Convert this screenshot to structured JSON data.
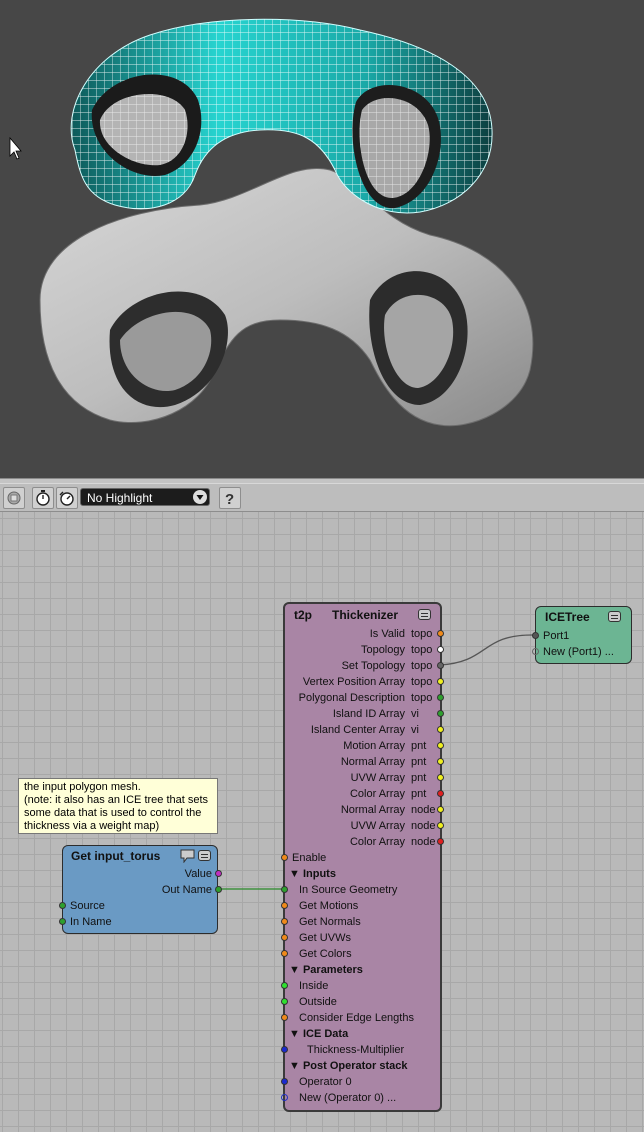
{
  "toolbar": {
    "highlight_value": "No Highlight"
  },
  "colors": {
    "viewport_bg": "#474747",
    "graph_bg": "#b9b9b9",
    "thickenizer_node": "#a985a5",
    "get_node": "#6a9ac4",
    "icetree_node": "#6cb593",
    "comment_bg": "#ffffd8",
    "wireframe_torus": "#25c9c6"
  },
  "comment": {
    "text": "the input polygon mesh.\n(note: it also has an ICE tree that sets some data that is used to control the thickness via a weight map)"
  },
  "get_node": {
    "title": "Get input_torus",
    "outputs": [
      "Value",
      "Out Name"
    ],
    "inputs": [
      "Source",
      "In Name"
    ]
  },
  "thickenizer": {
    "title_prefix": "t2p",
    "title": "Thickenizer",
    "outputs": [
      {
        "label": "Is Valid",
        "type": "topo"
      },
      {
        "label": "Topology",
        "type": "topo"
      },
      {
        "label": "Set Topology",
        "type": "topo"
      },
      {
        "label": "Vertex Position Array",
        "type": "topo"
      },
      {
        "label": "Polygonal Description",
        "type": "topo"
      },
      {
        "label": "Island ID Array",
        "type": "vi"
      },
      {
        "label": "Island Center Array",
        "type": "vi"
      },
      {
        "label": "Motion Array",
        "type": "pnt"
      },
      {
        "label": "Normal Array",
        "type": "pnt"
      },
      {
        "label": "UVW Array",
        "type": "pnt"
      },
      {
        "label": "Color Array",
        "type": "pnt"
      },
      {
        "label": "Normal Array",
        "type": "node"
      },
      {
        "label": "UVW Array",
        "type": "node"
      },
      {
        "label": "Color Array",
        "type": "node"
      }
    ],
    "enable": "Enable",
    "inputs_header": "Inputs",
    "inputs": [
      "In Source Geometry",
      "Get Motions",
      "Get Normals",
      "Get UVWs",
      "Get Colors"
    ],
    "parameters_header": "Parameters",
    "parameters": [
      "Inside",
      "Outside",
      "Consider Edge Lengths"
    ],
    "ice_header": "ICE Data",
    "ice": [
      "Thickness-Multiplier"
    ],
    "post_header": "Post Operator stack",
    "post": [
      "Operator 0",
      "New (Operator 0) ..."
    ]
  },
  "icetree": {
    "title": "ICETree",
    "ports": [
      "Port1",
      "New (Port1) ..."
    ]
  }
}
